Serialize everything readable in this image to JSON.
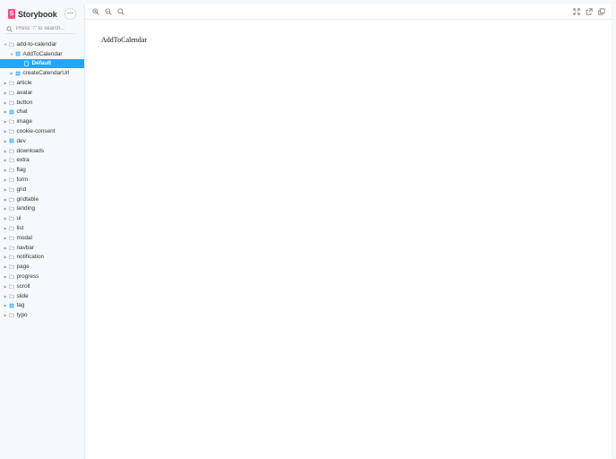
{
  "brand": {
    "logo_letter": "S",
    "name": "Storybook"
  },
  "menu_button": {
    "label": "···"
  },
  "search": {
    "placeholder": "Press \"/\" to search..."
  },
  "tree": [
    {
      "label": "add-to-calendar",
      "level": 0,
      "kind": "folder",
      "caret": "down"
    },
    {
      "label": "AddToCalendar",
      "level": 1,
      "kind": "component",
      "caret": "down"
    },
    {
      "label": "Default",
      "level": 2,
      "kind": "story",
      "caret": "none",
      "selected": true
    },
    {
      "label": "createCalendarUrl",
      "level": 1,
      "kind": "component",
      "caret": "right"
    },
    {
      "label": "article",
      "level": 0,
      "kind": "folder",
      "caret": "right"
    },
    {
      "label": "avatar",
      "level": 0,
      "kind": "folder",
      "caret": "right"
    },
    {
      "label": "button",
      "level": 0,
      "kind": "folder",
      "caret": "right"
    },
    {
      "label": "chat",
      "level": 0,
      "kind": "component",
      "caret": "right"
    },
    {
      "label": "image",
      "level": 0,
      "kind": "folder",
      "caret": "right"
    },
    {
      "label": "cookie-consent",
      "level": 0,
      "kind": "folder",
      "caret": "right"
    },
    {
      "label": "dev",
      "level": 0,
      "kind": "component",
      "caret": "right"
    },
    {
      "label": "downloads",
      "level": 0,
      "kind": "folder",
      "caret": "right"
    },
    {
      "label": "extra",
      "level": 0,
      "kind": "folder",
      "caret": "right"
    },
    {
      "label": "flag",
      "level": 0,
      "kind": "folder",
      "caret": "right"
    },
    {
      "label": "form",
      "level": 0,
      "kind": "folder",
      "caret": "right"
    },
    {
      "label": "grid",
      "level": 0,
      "kind": "folder",
      "caret": "right"
    },
    {
      "label": "gridtable",
      "level": 0,
      "kind": "folder",
      "caret": "right"
    },
    {
      "label": "landing",
      "level": 0,
      "kind": "folder",
      "caret": "right"
    },
    {
      "label": "ui",
      "level": 0,
      "kind": "folder",
      "caret": "right"
    },
    {
      "label": "list",
      "level": 0,
      "kind": "folder",
      "caret": "right"
    },
    {
      "label": "modal",
      "level": 0,
      "kind": "folder",
      "caret": "right"
    },
    {
      "label": "navbar",
      "level": 0,
      "kind": "folder",
      "caret": "right"
    },
    {
      "label": "notification",
      "level": 0,
      "kind": "folder",
      "caret": "right"
    },
    {
      "label": "page",
      "level": 0,
      "kind": "folder",
      "caret": "right"
    },
    {
      "label": "progress",
      "level": 0,
      "kind": "folder",
      "caret": "right"
    },
    {
      "label": "scroll",
      "level": 0,
      "kind": "folder",
      "caret": "right"
    },
    {
      "label": "slide",
      "level": 0,
      "kind": "folder",
      "caret": "right"
    },
    {
      "label": "tag",
      "level": 0,
      "kind": "component",
      "caret": "right"
    },
    {
      "label": "typo",
      "level": 0,
      "kind": "folder",
      "caret": "right"
    }
  ],
  "toolbar": {
    "left": [
      "zoom-in-icon",
      "zoom-out-icon",
      "zoom-reset-icon"
    ],
    "right": [
      "fullscreen-icon",
      "share-icon",
      "copy-link-icon"
    ]
  },
  "preview": {
    "story_text": "AddToCalendar"
  },
  "colors": {
    "accent": "#1ea7fd",
    "brand": "#ff4785",
    "folder_icon": "#a5b1bd",
    "component_icon": "#1ea7fd",
    "story_icon": "#ffffff"
  }
}
